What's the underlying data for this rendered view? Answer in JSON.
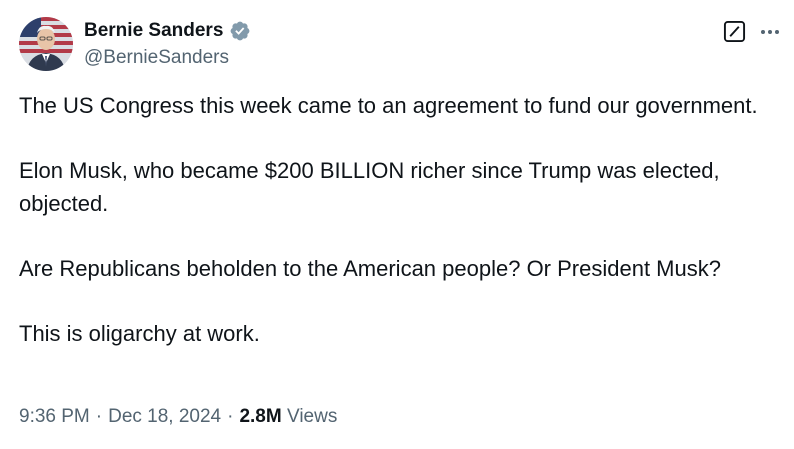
{
  "author": {
    "display_name": "Bernie Sanders",
    "handle": "@BernieSanders",
    "verified": true,
    "verified_badge_color": "#829aab",
    "avatar_icon": "avatar"
  },
  "header_actions": {
    "grok_icon": "grok-icon",
    "more_icon": "more-options-icon"
  },
  "tweet": {
    "paragraphs": [
      "The US Congress this week came to an agreement to fund our government.",
      "Elon Musk, who became $200 BILLION richer since Trump was elected, objected.",
      "Are Republicans beholden to the American people? Or President Musk?",
      "This is oligarchy at work."
    ]
  },
  "meta": {
    "time": "9:36 PM",
    "separator": "·",
    "date": "Dec 18, 2024",
    "views_count": "2.8M",
    "views_label": "Views"
  },
  "colors": {
    "text_primary": "#0f1419",
    "text_secondary": "#536471",
    "background": "#ffffff"
  }
}
